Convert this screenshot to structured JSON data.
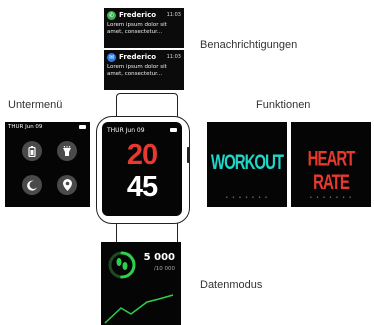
{
  "labels": {
    "notifications": "Benachrichtigungen",
    "submenu": "Untermenü",
    "functions": "Funktionen",
    "data_mode": "Datenmodus"
  },
  "notifications": [
    {
      "name": "Frederico",
      "time": "11:03",
      "text": "Lorem ipsum dolor sit amet, consectetur...",
      "app_color": "#3ab54a",
      "app_icon": "whatsapp-icon"
    },
    {
      "name": "Frederico",
      "time": "11:03",
      "text": "Lorem ipsum dolor sit amet, consectetur...",
      "app_color": "#2d7be5",
      "app_icon": "messenger-icon"
    }
  ],
  "submenu": {
    "status": "THUR  Jun 09",
    "icons": [
      "battery-icon",
      "flashlight-icon",
      "moon-icon",
      "location-pin-icon"
    ]
  },
  "watch": {
    "date": "THUR  Jun 09",
    "hour": "20",
    "minute": "45",
    "hour_color": "#e8392e",
    "minute_color": "#ffffff"
  },
  "functions": [
    {
      "title": "WORKOUT",
      "color": "#1fd6c8",
      "dots": "• • • • • • •"
    },
    {
      "title": "HEART RATE",
      "color": "#e8392e",
      "dots": "• • • • • • •"
    }
  ],
  "data_mode": {
    "steps": "5 000",
    "goal": "/10 000",
    "ring_color": "#2fcf4a",
    "progress": 0.5
  }
}
